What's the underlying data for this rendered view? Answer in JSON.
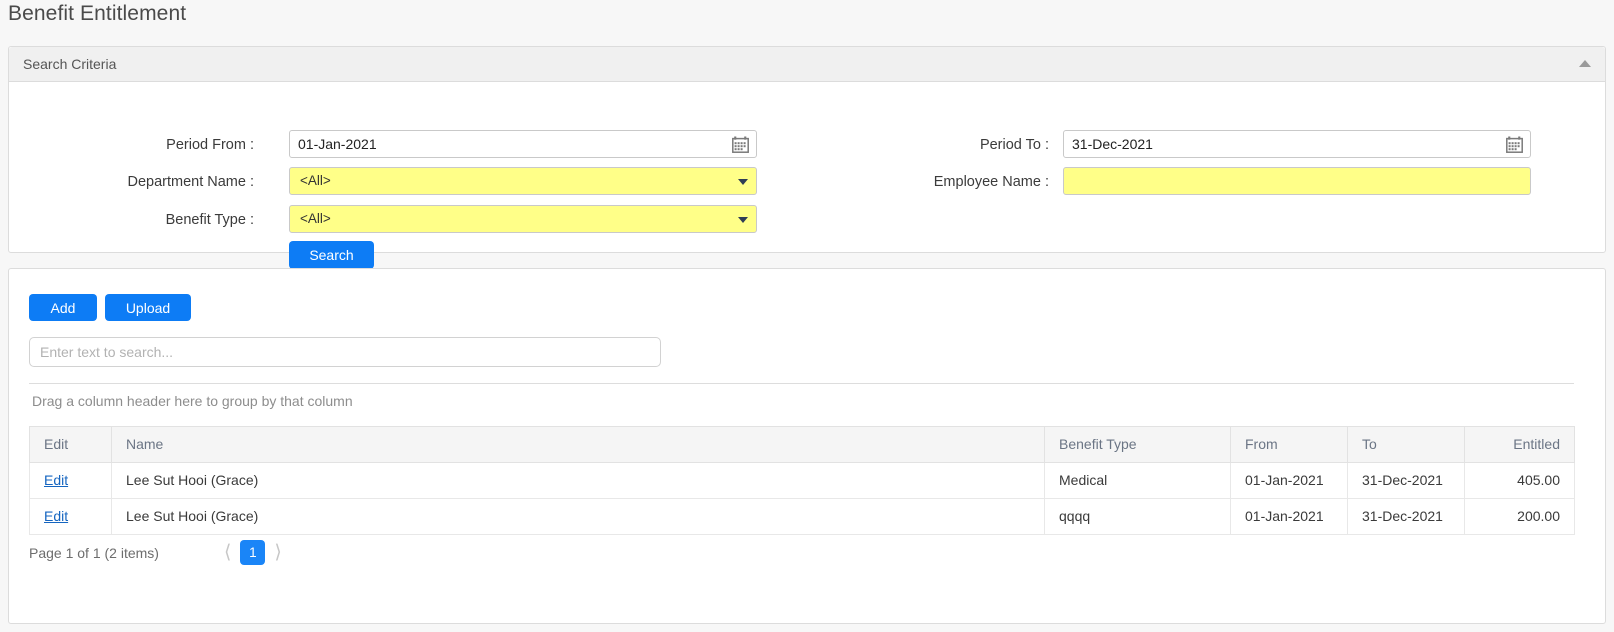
{
  "page": {
    "title": "Benefit Entitlement"
  },
  "search_panel": {
    "header": "Search Criteria",
    "collapse_icon": "chevron-up-icon",
    "fields": {
      "period_from_label": "Period From :",
      "period_from_value": "01-Jan-2021",
      "period_to_label": "Period To :",
      "period_to_value": "31-Dec-2021",
      "department_label": "Department Name :",
      "department_value": "<All>",
      "employee_label": "Employee Name :",
      "employee_value": "",
      "employee_placeholder": "",
      "benefit_type_label": "Benefit Type :",
      "benefit_type_value": "<All>"
    },
    "calendar_icon": "calendar-icon",
    "search_button": "Search"
  },
  "results_panel": {
    "add_button": "Add",
    "upload_button": "Upload",
    "search_placeholder": "Enter text to search...",
    "search_value": "",
    "group_hint": "Drag a column header here to group by that column",
    "columns": [
      "Edit",
      "Name",
      "Benefit Type",
      "From",
      "To",
      "Entitled"
    ],
    "rows": [
      {
        "edit": "Edit",
        "name": "Lee Sut Hooi (Grace)",
        "benefit_type": "Medical",
        "from": "01-Jan-2021",
        "to": "31-Dec-2021",
        "entitled": "405.00"
      },
      {
        "edit": "Edit",
        "name": "Lee Sut Hooi (Grace)",
        "benefit_type": "qqqq",
        "from": "01-Jan-2021",
        "to": "31-Dec-2021",
        "entitled": "200.00"
      }
    ],
    "pager": {
      "info": "Page 1 of 1 (2 items)",
      "prev_icon": "chevron-left-icon",
      "next_icon": "chevron-right-icon",
      "current_page": "1"
    }
  },
  "colors": {
    "accent_blue": "#0d7cf5",
    "highlight_yellow": "#ffff88",
    "link_blue": "#1565c0",
    "panel_header_gray": "#f0f0f0"
  }
}
